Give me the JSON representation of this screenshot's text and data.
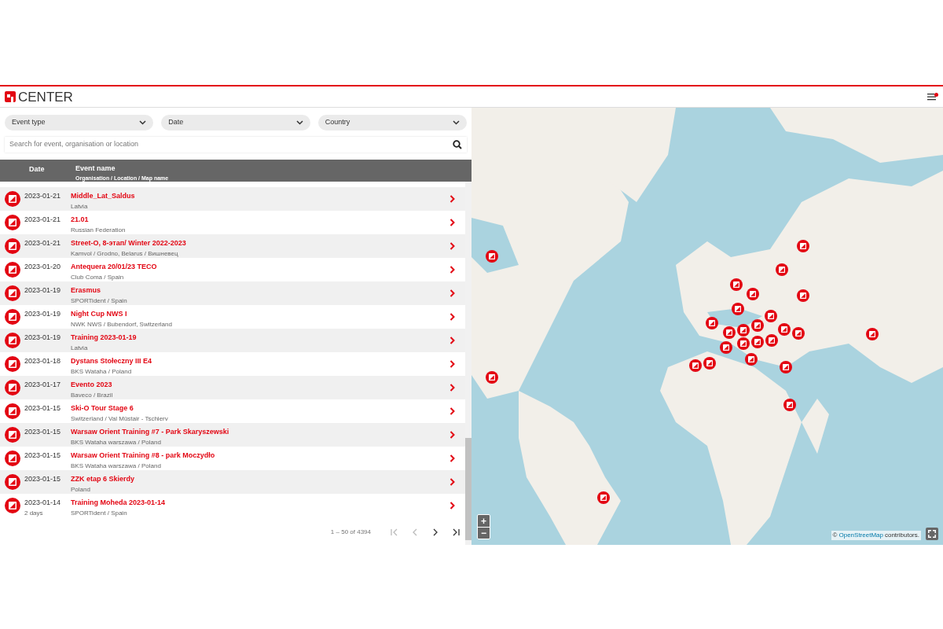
{
  "header": {
    "logo_text": "CENTER"
  },
  "filters": [
    {
      "label": "Event type"
    },
    {
      "label": "Date"
    },
    {
      "label": "Country"
    }
  ],
  "search": {
    "placeholder": "Search for event, organisation or location"
  },
  "table": {
    "columns": [
      "Date",
      "Event name"
    ],
    "column_subtitle": "Organisation / Location / Map name",
    "rows": [
      {
        "date": "2023-01-21",
        "name": "Middle_Lat_Saldus",
        "sub": "Latvia"
      },
      {
        "date": "2023-01-21",
        "name": "21.01",
        "sub": "Russian Federation"
      },
      {
        "date": "2023-01-21",
        "name": "Street-O, 8-этап/ Winter 2022-2023",
        "sub": "Kamvol / Grodno, Belarus / Вишневец"
      },
      {
        "date": "2023-01-20",
        "name": "Antequera 20/01/23 TECO",
        "sub": "Club Coma / Spain"
      },
      {
        "date": "2023-01-19",
        "name": "Erasmus",
        "sub": "SPORTident / Spain"
      },
      {
        "date": "2023-01-19",
        "name": "Night Cup NWS I",
        "sub": "NWK NWS / Bubendorf, Switzerland"
      },
      {
        "date": "2023-01-19",
        "name": "Training 2023-01-19",
        "sub": "Latvia"
      },
      {
        "date": "2023-01-18",
        "name": "Dystans Stołeczny III E4",
        "sub": "BKS Wataha / Poland"
      },
      {
        "date": "2023-01-17",
        "name": "Evento 2023",
        "sub": "Baveco / Brazil"
      },
      {
        "date": "2023-01-15",
        "name": "Ski-O Tour Stage 6",
        "sub": "Switzerland / Val Müstair - Tschierv"
      },
      {
        "date": "2023-01-15",
        "name": "Warsaw Orient Training #7 - Park Skaryszewski",
        "sub": "BKS Wataha warszawa / Poland"
      },
      {
        "date": "2023-01-15",
        "name": "Warsaw Orient Training #8 - park Moczydło",
        "sub": "BKS Wataha warszawa / Poland"
      },
      {
        "date": "2023-01-15",
        "name": "ZZK etap 6 Skierdy",
        "sub": "Poland"
      },
      {
        "date": "2023-01-14",
        "duration": "2 days",
        "name": "Training Moheda 2023-01-14",
        "sub": "SPORTident / Spain"
      }
    ]
  },
  "pagination": {
    "range": "1 – 50 of 4394"
  },
  "map": {
    "zoom_in": "+",
    "zoom_out": "−",
    "attribution_prefix": "©",
    "attribution_link": "OpenStreetMap",
    "attribution_suffix": "contributors."
  }
}
